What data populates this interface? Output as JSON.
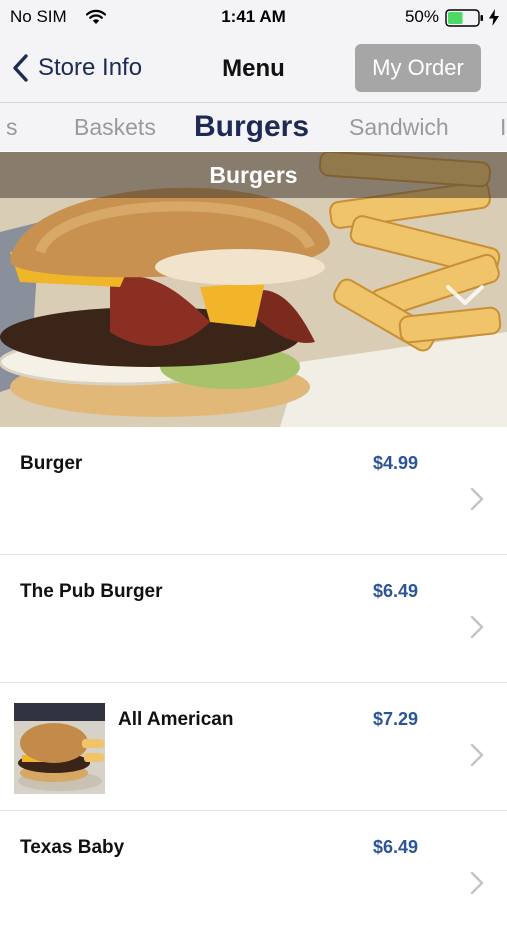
{
  "status_bar": {
    "carrier": "No SIM",
    "time": "1:41 AM",
    "battery_percent": "50%",
    "battery_level": 0.5,
    "battery_color": "#4cd964"
  },
  "nav": {
    "back_label": "Store Info",
    "title": "Menu",
    "order_button_label": "My Order"
  },
  "tabs": [
    {
      "label": "s",
      "active": false
    },
    {
      "label": "Baskets",
      "active": false
    },
    {
      "label": "Burgers",
      "active": true
    },
    {
      "label": "Sandwich",
      "active": false
    },
    {
      "label": "I",
      "active": false
    }
  ],
  "hero": {
    "title": "Burgers"
  },
  "menu_items": [
    {
      "name": "Burger",
      "price": "$4.99",
      "has_thumbnail": false
    },
    {
      "name": "The Pub Burger",
      "price": "$6.49",
      "has_thumbnail": false
    },
    {
      "name": "All American",
      "price": "$7.29",
      "has_thumbnail": true
    },
    {
      "name": "Texas Baby",
      "price": "$6.49",
      "has_thumbnail": false
    }
  ],
  "colors": {
    "accent": "#1c2a55",
    "price": "#2d5596",
    "order_button": "#a6a6a6"
  }
}
